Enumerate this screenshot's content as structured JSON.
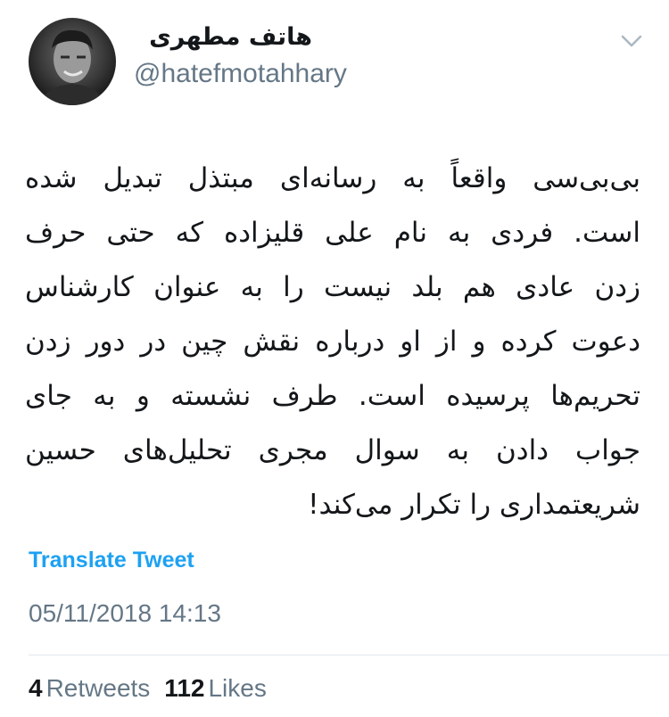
{
  "author": {
    "display_name": "هاتف مطهری",
    "handle": "@hatefmotahhary",
    "avatar_icon": "profile-photo"
  },
  "menu_icon": "chevron-down-icon",
  "tweet": {
    "lines": [
      "بی‌بی‌سی واقعاً به رسانه‌ای مبتذل تبدیل شده",
      "است. فردی به نام علی قلیزاده که حتی حرف",
      "زدن عادی هم بلد نیست را به عنوان کارشناس",
      "دعوت کرده و از او درباره نقش چین در دور زدن",
      "تحریم‌ها پرسیده است. طرف نشسته و به جای",
      "جواب دادن به سوال مجری تحلیل‌های حسین",
      "شریعتمداری را تکرار می‌کند!"
    ]
  },
  "translate_label": "Translate Tweet",
  "timestamp": "05/11/2018 14:13",
  "stats": {
    "retweets_count": "4",
    "retweets_label": "Retweets",
    "likes_count": "112",
    "likes_label": "Likes"
  },
  "colors": {
    "link": "#1da1f2",
    "secondary_text": "#657786",
    "primary_text": "#14171a",
    "divider": "#e1e8ed"
  }
}
